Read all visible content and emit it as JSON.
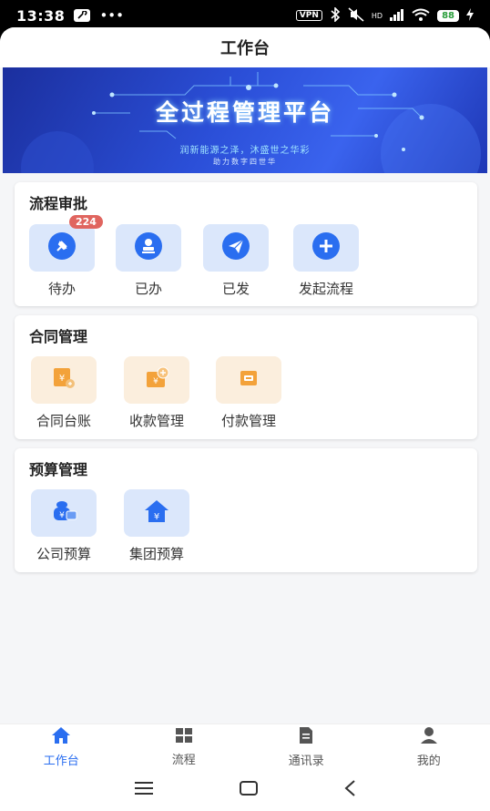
{
  "status_bar": {
    "time": "13:38",
    "dots": "•••",
    "vpn": "VPN",
    "hd": "HD",
    "battery": "88"
  },
  "header": {
    "title": "工作台"
  },
  "banner": {
    "title": "全过程管理平台",
    "subtitle": "润新能源之泽，沐盛世之华彩",
    "tagline": "助力数字四世华"
  },
  "sections": {
    "approval": {
      "title": "流程审批",
      "items": [
        {
          "label": "待办",
          "badge": "224",
          "icon": "pin-icon"
        },
        {
          "label": "已办",
          "icon": "stamp-icon"
        },
        {
          "label": "已发",
          "icon": "paper-plane-icon"
        },
        {
          "label": "发起流程",
          "icon": "plus-icon"
        }
      ]
    },
    "contract": {
      "title": "合同管理",
      "items": [
        {
          "label": "合同台账",
          "icon": "ledger-icon"
        },
        {
          "label": "收款管理",
          "icon": "receipt-icon"
        },
        {
          "label": "付款管理",
          "icon": "payment-icon"
        }
      ]
    },
    "budget": {
      "title": "预算管理",
      "items": [
        {
          "label": "公司预算",
          "icon": "money-bag-icon"
        },
        {
          "label": "集团预算",
          "icon": "house-yen-icon"
        }
      ]
    }
  },
  "tabbar": {
    "items": [
      {
        "label": "工作台",
        "icon": "home-icon",
        "active": true
      },
      {
        "label": "流程",
        "icon": "grid-icon"
      },
      {
        "label": "通讯录",
        "icon": "contacts-icon"
      },
      {
        "label": "我的",
        "icon": "user-icon"
      }
    ]
  },
  "colors": {
    "accent": "#2a6ef0",
    "tile_blue": "#dbe7fb",
    "tile_orange": "#fbeedd",
    "badge": "#e0655f",
    "icon_orange": "#f3a23a"
  }
}
